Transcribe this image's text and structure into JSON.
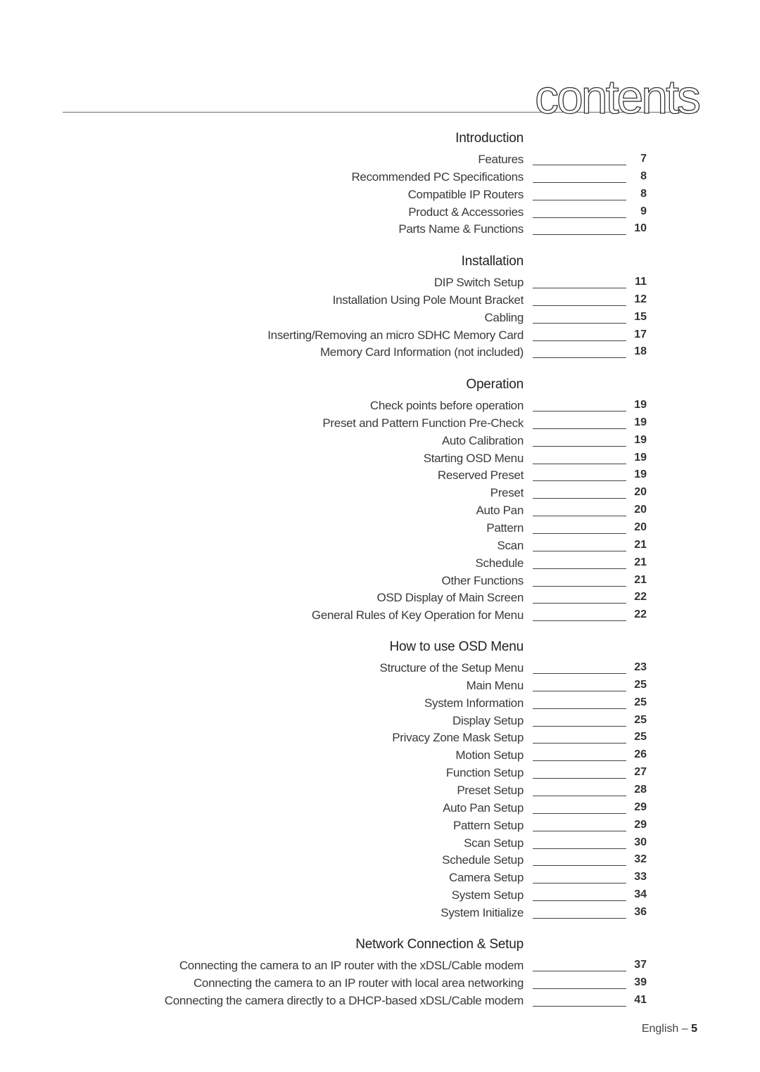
{
  "page": {
    "title": "contents",
    "footer": {
      "language": "English",
      "separator": " – ",
      "page_number": "5"
    }
  },
  "sections": [
    {
      "heading": "Introduction",
      "entries": [
        {
          "label": "Features",
          "page": "7"
        },
        {
          "label": "Recommended PC Specifications",
          "page": "8"
        },
        {
          "label": "Compatible IP Routers",
          "page": "8"
        },
        {
          "label": "Product & Accessories",
          "page": "9"
        },
        {
          "label": "Parts Name & Functions",
          "page": "10"
        }
      ]
    },
    {
      "heading": "Installation",
      "entries": [
        {
          "label": "DIP Switch Setup",
          "page": "11"
        },
        {
          "label": "Installation Using Pole Mount Bracket",
          "page": "12"
        },
        {
          "label": "Cabling",
          "page": "15"
        },
        {
          "label": "Inserting/Removing an micro SDHC Memory Card",
          "page": "17"
        },
        {
          "label": "Memory Card Information (not included)",
          "page": "18"
        }
      ]
    },
    {
      "heading": "Operation",
      "entries": [
        {
          "label": "Check points before operation",
          "page": "19"
        },
        {
          "label": "Preset and Pattern Function Pre-Check",
          "page": "19"
        },
        {
          "label": "Auto Calibration",
          "page": "19"
        },
        {
          "label": "Starting OSD Menu",
          "page": "19"
        },
        {
          "label": "Reserved Preset",
          "page": "19"
        },
        {
          "label": "Preset",
          "page": "20"
        },
        {
          "label": "Auto Pan",
          "page": "20"
        },
        {
          "label": "Pattern",
          "page": "20"
        },
        {
          "label": "Scan",
          "page": "21"
        },
        {
          "label": "Schedule",
          "page": "21"
        },
        {
          "label": "Other Functions",
          "page": "21"
        },
        {
          "label": "OSD Display of Main Screen",
          "page": "22"
        },
        {
          "label": "General Rules of Key Operation for Menu",
          "page": "22"
        }
      ]
    },
    {
      "heading": "How to use OSD Menu",
      "entries": [
        {
          "label": "Structure of the Setup Menu",
          "page": "23"
        },
        {
          "label": "Main Menu",
          "page": "25"
        },
        {
          "label": "System Information",
          "page": "25"
        },
        {
          "label": "Display Setup",
          "page": "25"
        },
        {
          "label": "Privacy Zone Mask Setup",
          "page": "25"
        },
        {
          "label": "Motion Setup",
          "page": "26"
        },
        {
          "label": "Function Setup",
          "page": "27"
        },
        {
          "label": "Preset Setup",
          "page": "28"
        },
        {
          "label": "Auto Pan Setup",
          "page": "29"
        },
        {
          "label": "Pattern Setup",
          "page": "29"
        },
        {
          "label": "Scan Setup",
          "page": "30"
        },
        {
          "label": "Schedule Setup",
          "page": "32"
        },
        {
          "label": "Camera Setup",
          "page": "33"
        },
        {
          "label": "System Setup",
          "page": "34"
        },
        {
          "label": "System Initialize",
          "page": "36"
        }
      ]
    },
    {
      "heading": "Network Connection & Setup",
      "entries": [
        {
          "label": "Connecting the camera to an IP router with the xDSL/Cable modem",
          "page": "37"
        },
        {
          "label": "Connecting the camera to an IP router with local area networking",
          "page": "39"
        },
        {
          "label": "Connecting the camera directly to a DHCP-based xDSL/Cable modem",
          "page": "41"
        }
      ]
    }
  ]
}
